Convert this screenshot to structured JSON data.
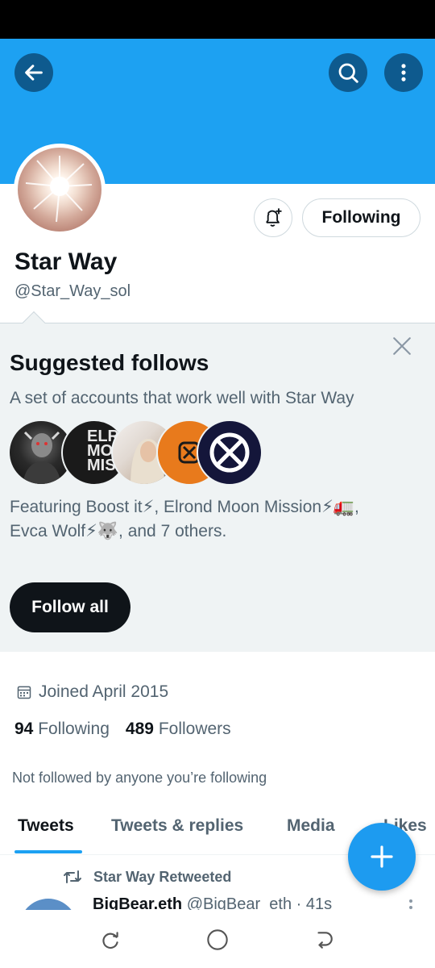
{
  "profile": {
    "display_name": "Star Way",
    "handle": "@Star_Way_sol",
    "following_label": "Following",
    "joined": "Joined April 2015",
    "following_count": "94",
    "following_word": "Following",
    "followers_count": "489",
    "followers_word": "Followers",
    "not_followed_text": "Not followed by anyone you’re following"
  },
  "header": {
    "back_icon": "arrow-left-icon",
    "search_icon": "search-icon",
    "more_icon": "more-vertical-icon",
    "banner_color": "#1da1f2"
  },
  "suggested": {
    "title": "Suggested follows",
    "subtitle": "A set of accounts that work well with Star Way",
    "featuring_line1": "Featuring Boost it⚡, Elrond Moon Mission⚡🚛,",
    "featuring_line2": "Evca Wolf⚡🐺, and 7 others.",
    "follow_all_label": "Follow all",
    "avatar2_text": "ELRO MOO MISS"
  },
  "tabs": [
    {
      "label": "Tweets"
    },
    {
      "label": "Tweets & replies"
    },
    {
      "label": "Media"
    },
    {
      "label": "Likes"
    }
  ],
  "tweet": {
    "retweet_label": "Star Way Retweeted",
    "author_name": "BigBear.eth",
    "author_meta": "@BigBear_eth · 41s"
  },
  "colors": {
    "accent": "#1d9bf0",
    "text_primary": "#0f1419",
    "text_secondary": "#536471"
  }
}
